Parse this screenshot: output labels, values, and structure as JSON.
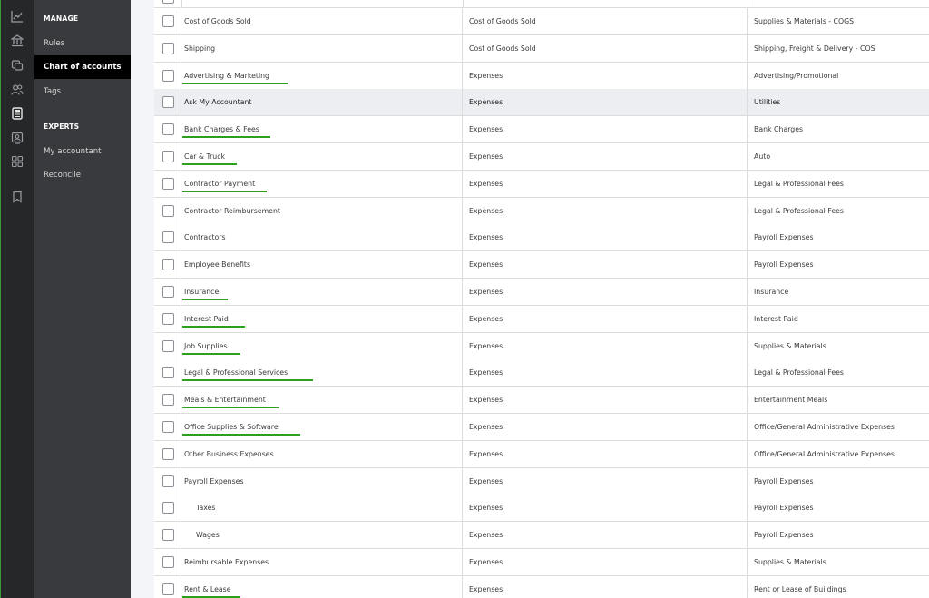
{
  "rail_icons": [
    "chart-line-icon",
    "bank-icon",
    "receipt-icon",
    "people-icon",
    "calculator-icon",
    "id-card-icon",
    "apps-grid-icon",
    "bookmark-icon"
  ],
  "menu": {
    "sections": [
      {
        "heading": "MANAGE",
        "items": [
          "Rules",
          "Chart of accounts",
          "Tags"
        ]
      },
      {
        "heading": "EXPERTS",
        "items": [
          "My accountant",
          "Reconcile"
        ]
      }
    ],
    "active_item": "Chart of accounts"
  },
  "accounts": {
    "rows": [
      {
        "name": "Cost of Goods Sold",
        "type": "Cost of Goods Sold",
        "detail": "Supplies & Materials - COGS",
        "underlined": false,
        "sub": false,
        "highlighted": false
      },
      {
        "name": "Shipping",
        "type": "Cost of Goods Sold",
        "detail": "Shipping, Freight & Delivery - COS",
        "underlined": false,
        "sub": false,
        "highlighted": false
      },
      {
        "name": "Advertising & Marketing",
        "type": "Expenses",
        "detail": "Advertising/Promotional",
        "underlined": true,
        "sub": false,
        "highlighted": false
      },
      {
        "name": "Ask My Accountant",
        "type": "Expenses",
        "detail": "Utilities",
        "underlined": false,
        "sub": false,
        "highlighted": true
      },
      {
        "name": "Bank Charges & Fees",
        "type": "Expenses",
        "detail": "Bank Charges",
        "underlined": true,
        "sub": false,
        "highlighted": false
      },
      {
        "name": "Car & Truck",
        "type": "Expenses",
        "detail": "Auto",
        "underlined": true,
        "sub": false,
        "highlighted": false
      },
      {
        "name": "Contractor Payment",
        "type": "Expenses",
        "detail": "Legal & Professional Fees",
        "underlined": true,
        "sub": false,
        "highlighted": false
      },
      {
        "name": "Contractor Reimbursement",
        "type": "Expenses",
        "detail": "Legal & Professional Fees",
        "underlined": false,
        "sub": false,
        "highlighted": false
      },
      {
        "name": "Contractors",
        "type": "Expenses",
        "detail": "Payroll Expenses",
        "underlined": false,
        "sub": false,
        "highlighted": false
      },
      {
        "name": "Employee Benefits",
        "type": "Expenses",
        "detail": "Payroll Expenses",
        "underlined": false,
        "sub": false,
        "highlighted": false
      },
      {
        "name": "Insurance",
        "type": "Expenses",
        "detail": "Insurance",
        "underlined": true,
        "sub": false,
        "highlighted": false
      },
      {
        "name": "Interest Paid",
        "type": "Expenses",
        "detail": "Interest Paid",
        "underlined": true,
        "sub": false,
        "highlighted": false
      },
      {
        "name": "Job Supplies",
        "type": "Expenses",
        "detail": "Supplies & Materials",
        "underlined": true,
        "sub": false,
        "highlighted": false
      },
      {
        "name": "Legal & Professional Services",
        "type": "Expenses",
        "detail": "Legal & Professional Fees",
        "underlined": true,
        "sub": false,
        "highlighted": false
      },
      {
        "name": "Meals & Entertainment",
        "type": "Expenses",
        "detail": "Entertainment Meals",
        "underlined": true,
        "sub": false,
        "highlighted": false
      },
      {
        "name": "Office Supplies & Software",
        "type": "Expenses",
        "detail": "Office/General Administrative Expenses",
        "underlined": true,
        "sub": false,
        "highlighted": false
      },
      {
        "name": "Other Business Expenses",
        "type": "Expenses",
        "detail": "Office/General Administrative Expenses",
        "underlined": false,
        "sub": false,
        "highlighted": false
      },
      {
        "name": "Payroll Expenses",
        "type": "Expenses",
        "detail": "Payroll Expenses",
        "underlined": false,
        "sub": false,
        "highlighted": false
      },
      {
        "name": "Taxes",
        "type": "Expenses",
        "detail": "Payroll Expenses",
        "underlined": false,
        "sub": true,
        "highlighted": false
      },
      {
        "name": "Wages",
        "type": "Expenses",
        "detail": "Payroll Expenses",
        "underlined": false,
        "sub": true,
        "highlighted": false
      },
      {
        "name": "Reimbursable Expenses",
        "type": "Expenses",
        "detail": "Supplies & Materials",
        "underlined": false,
        "sub": false,
        "highlighted": false
      },
      {
        "name": "Rent & Lease",
        "type": "Expenses",
        "detail": "Rent or Lease of Buildings",
        "underlined": true,
        "sub": false,
        "highlighted": false
      }
    ]
  },
  "colors": {
    "annotation_underline": "#2ca01c",
    "sidebar_dark": "#262729",
    "menu_bg": "#393a3d",
    "active_item_bg": "#000000"
  }
}
